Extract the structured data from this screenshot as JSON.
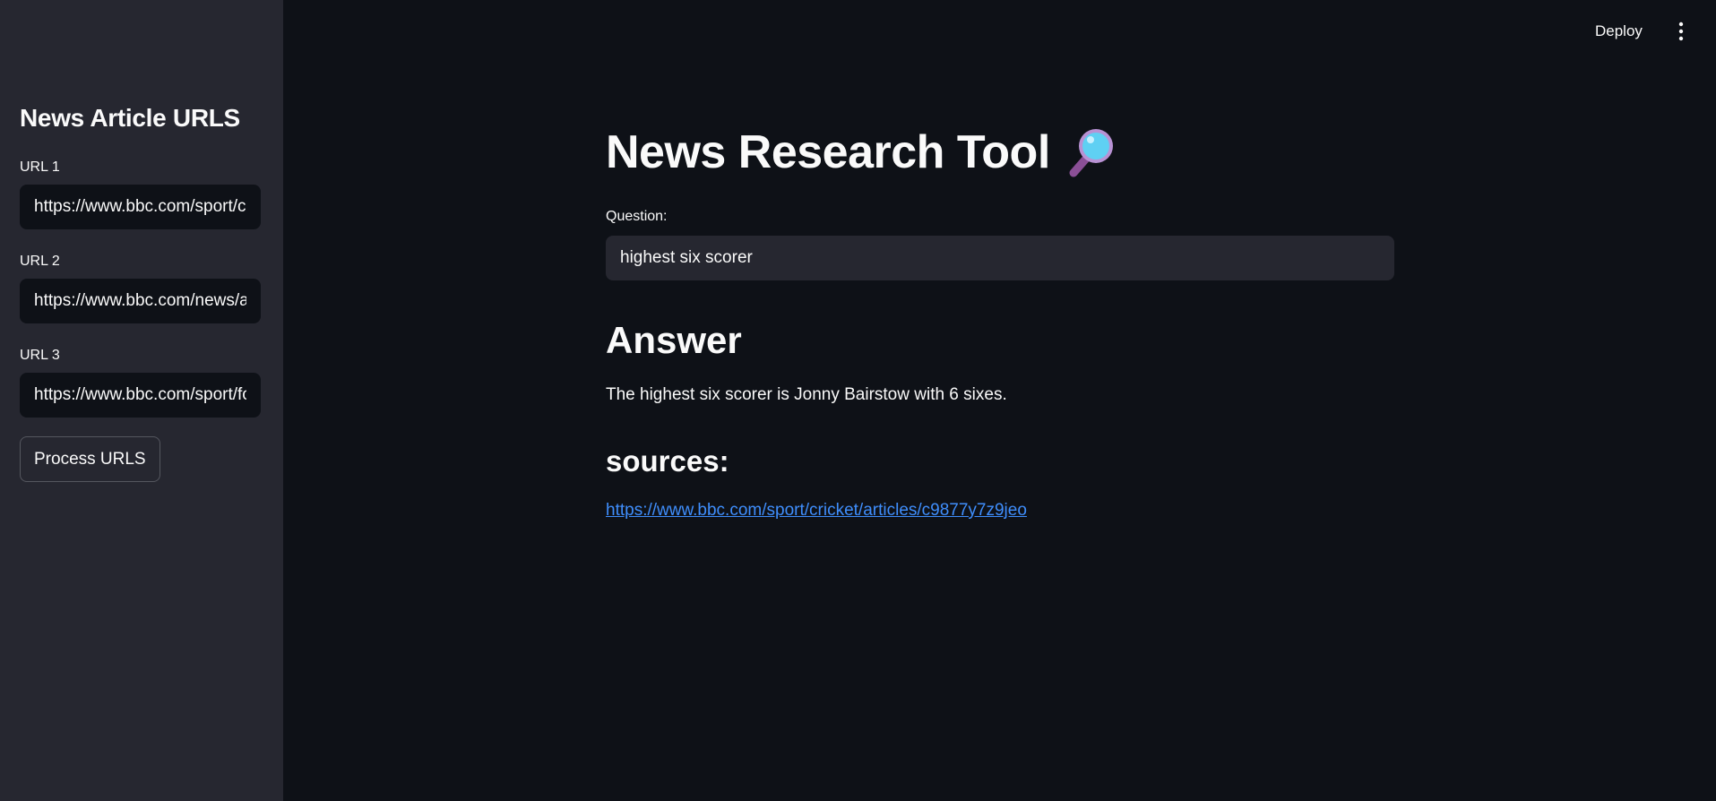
{
  "sidebar": {
    "title": "News Article URLS",
    "urls": [
      {
        "label": "URL 1",
        "value": "https://www.bbc.com/sport/cricket"
      },
      {
        "label": "URL 2",
        "value": "https://www.bbc.com/news/articles"
      },
      {
        "label": "URL 3",
        "value": "https://www.bbc.com/sport/football"
      }
    ],
    "process_button": "Process URLS"
  },
  "header": {
    "deploy_label": "Deploy",
    "menu_icon": "vertical-ellipsis-icon"
  },
  "main": {
    "title": "News Research Tool",
    "title_icon": "magnifying-glass-icon",
    "question_label": "Question:",
    "question_value": "highest six scorer",
    "answer_heading": "Answer",
    "answer_text": "The highest six scorer is Jonny Bairstow with 6 sixes.",
    "sources_heading": "sources:",
    "sources": [
      "https://www.bbc.com/sport/cricket/articles/c9877y7z9jeo"
    ]
  },
  "colors": {
    "background": "#0e1117",
    "sidebar": "#262730",
    "text": "#fafafa",
    "link": "#3f8efc"
  }
}
